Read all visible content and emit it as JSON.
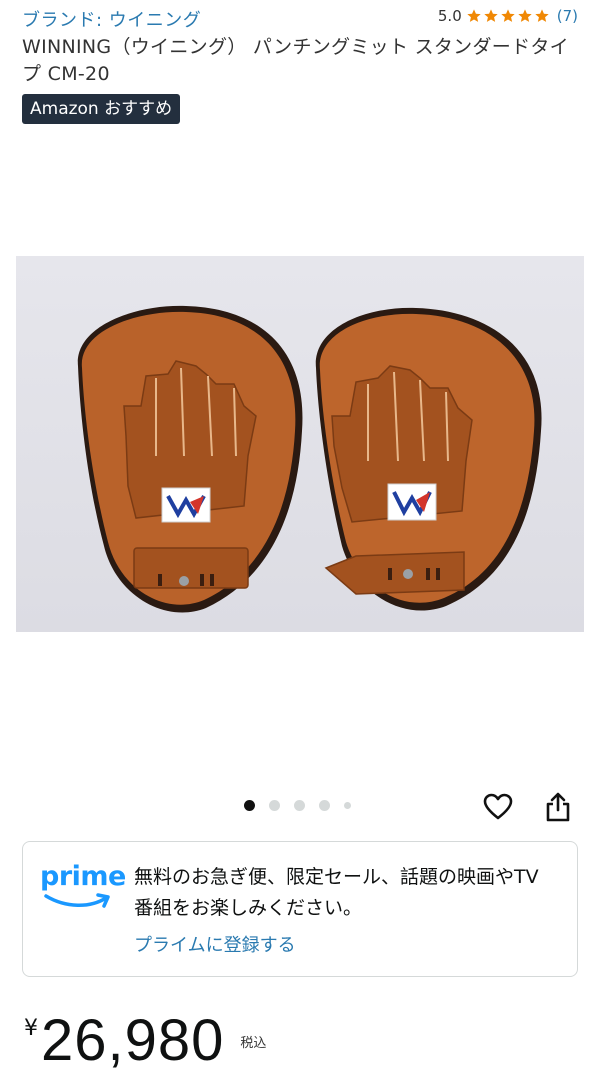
{
  "brand": {
    "link": "ブランド: ウイニング"
  },
  "rating": {
    "value": "5.0",
    "stars": 5,
    "count": "(7)",
    "star_color": "#f08804"
  },
  "product": {
    "title": "WINNING（ウイニング） パンチングミット スタンダードタイプ CM-20",
    "badge": "Amazon おすすめ"
  },
  "carousel": {
    "total": 5,
    "active_index": 0
  },
  "icons": {
    "wishlist": "heart-icon",
    "share": "share-icon"
  },
  "prime": {
    "logo_text": "prime",
    "message": "無料のお急ぎ便、限定セール、話題の映画やTV番組をお楽しみください。",
    "signup_link": "プライムに登録する",
    "brand_color": "#1a98ff"
  },
  "price": {
    "currency": "¥",
    "amount": "26,980",
    "tax_note": "税込"
  }
}
